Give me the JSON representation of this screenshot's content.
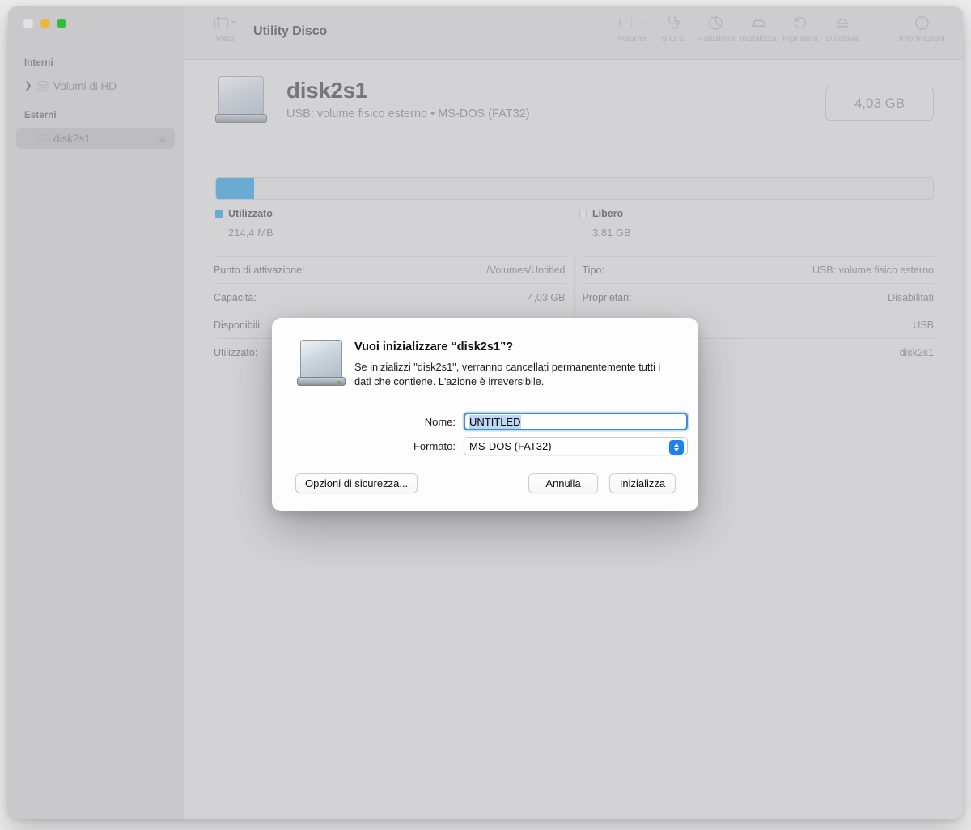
{
  "window": {
    "traffic_lights": [
      "close",
      "minimize",
      "maximize"
    ]
  },
  "toolbar": {
    "view_label": "Vista",
    "app_title": "Utility Disco",
    "items": [
      {
        "label": "Volume",
        "icon": "plus-minus-icon"
      },
      {
        "label": "S.O.S.",
        "icon": "stethoscope-icon"
      },
      {
        "label": "Partiziona",
        "icon": "pie-chart-icon"
      },
      {
        "label": "Inizializza",
        "icon": "eraser-icon"
      },
      {
        "label": "Ripristina",
        "icon": "undo-arrow-icon"
      },
      {
        "label": "Disattiva",
        "icon": "eject-icon"
      },
      {
        "label": "Informazioni",
        "icon": "info-circle-icon"
      }
    ]
  },
  "sidebar": {
    "sections": [
      {
        "title": "Interni",
        "items": [
          {
            "label": "Volumi di HD",
            "icon": "stacked-disks-icon",
            "selected": false,
            "expandable": true
          }
        ]
      },
      {
        "title": "Esterni",
        "items": [
          {
            "label": "disk2s1",
            "icon": "external-drive-icon",
            "selected": true,
            "eject": true
          }
        ]
      }
    ]
  },
  "volume": {
    "name": "disk2s1",
    "subtitle": "USB: volume fisico esterno • MS-DOS (FAT32)",
    "capacity_badge": "4,03 GB"
  },
  "storage": {
    "used_percent": 5.3,
    "legend": [
      {
        "name": "Utilizzato",
        "value": "214,4 MB",
        "color": "#6aabd2"
      },
      {
        "name": "Libero",
        "value": "3,81 GB",
        "color": "#d7d7d9"
      }
    ]
  },
  "info": {
    "left": [
      {
        "key": "Punto di attivazione:",
        "value": "/Volumes/Untitled"
      },
      {
        "key": "Capacità:",
        "value": "4,03 GB"
      },
      {
        "key": "Disponibili:",
        "value": ""
      },
      {
        "key": "Utilizzato:",
        "value": ""
      }
    ],
    "right": [
      {
        "key": "Tipo:",
        "value": "USB: volume fisico esterno"
      },
      {
        "key": "Proprietari:",
        "value": "Disabilitati"
      },
      {
        "key": "",
        "value": "USB"
      },
      {
        "key": "",
        "value": "disk2s1"
      }
    ]
  },
  "dialog": {
    "title": "Vuoi inizializzare “disk2s1”?",
    "body": "Se inizializzi \"disk2s1\", verranno cancellati permanentemente tutti i dati che contiene. L'azione è irreversibile.",
    "name_label": "Nome:",
    "name_value": "UNTITLED",
    "format_label": "Formato:",
    "format_value": "MS-DOS (FAT32)",
    "security_button": "Opzioni di sicurezza...",
    "cancel_button": "Annulla",
    "erase_button": "Inizializza"
  },
  "colors": {
    "accent_blue": "#1a83f0",
    "used_blue": "#6aabd2",
    "window_bg": "#d3d3d5",
    "sidebar_bg": "#c9c9cb"
  }
}
